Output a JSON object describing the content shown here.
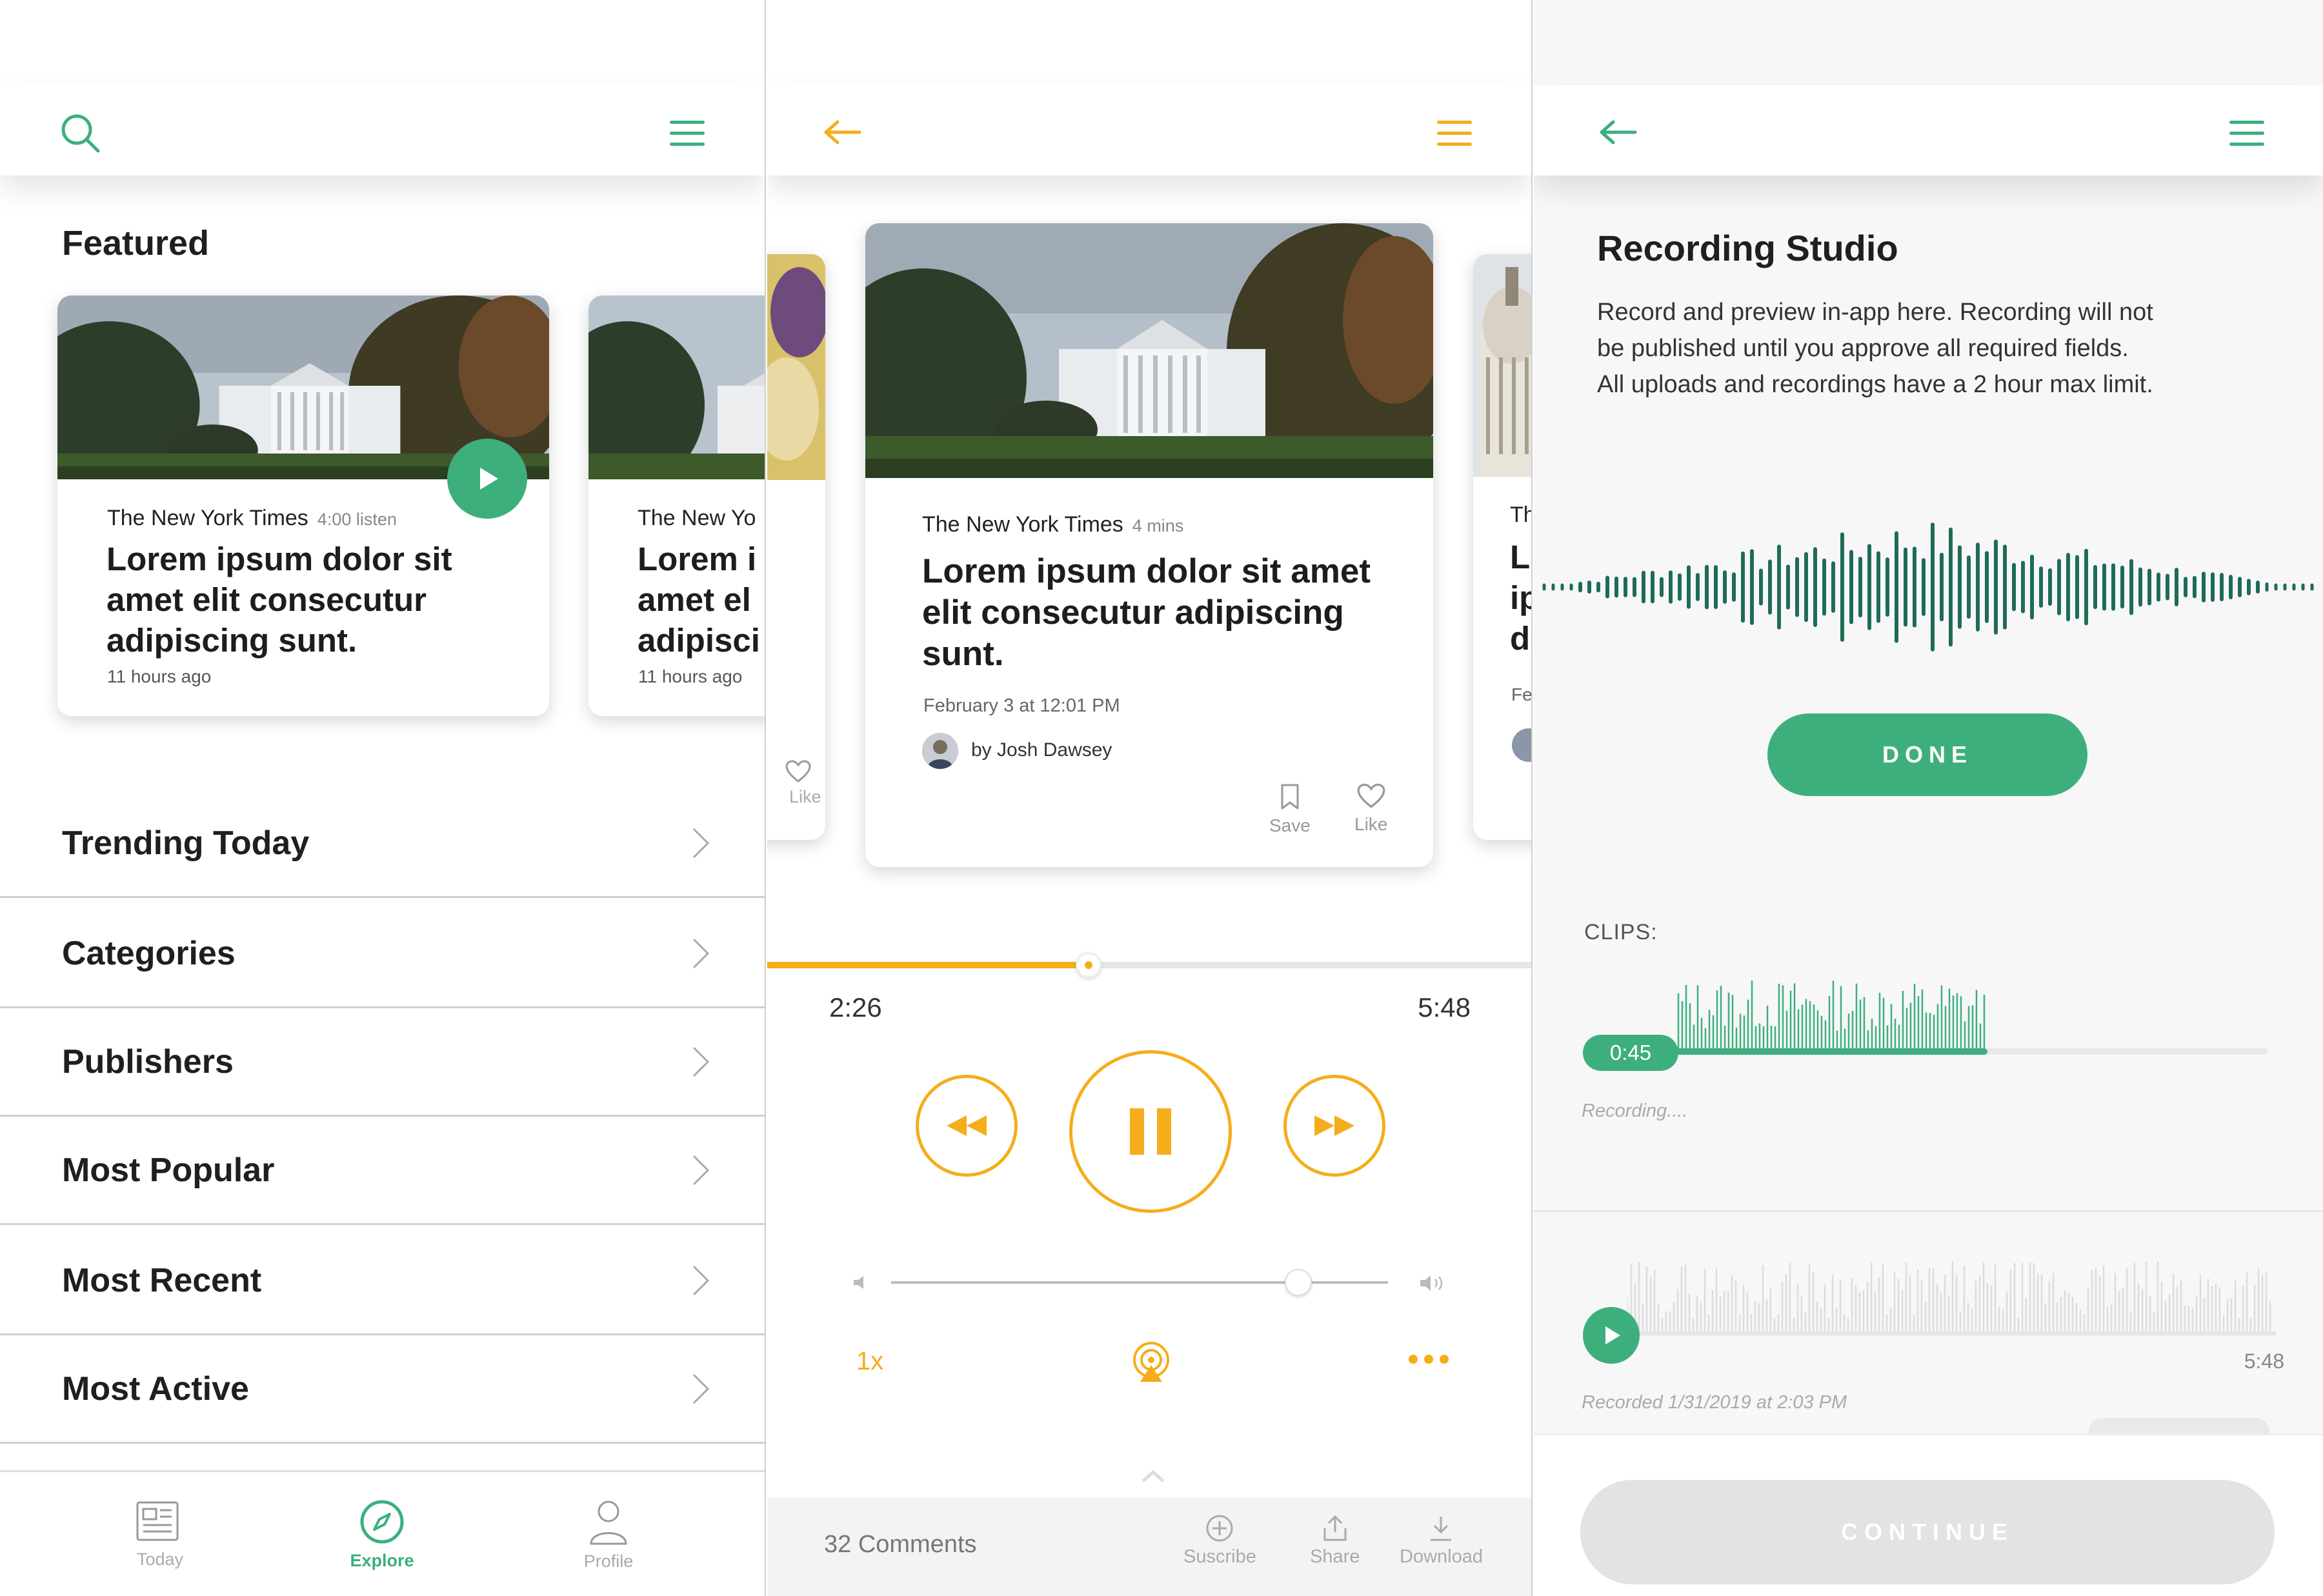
{
  "colors": {
    "green": "#3daf7d",
    "dark_green": "#1f6b5a",
    "orange": "#f5ad1b",
    "gray_line": "#cfcfcf"
  },
  "explore": {
    "featured_heading": "Featured",
    "cards": [
      {
        "publisher": "The New York Times",
        "duration": "4:00 listen",
        "title_lines": [
          "Lorem ipsum dolor sit",
          "amet elit consecutur",
          "adipiscing sunt."
        ],
        "ago": "11 hours ago"
      },
      {
        "publisher": "The New Yo",
        "title_lines": [
          "Lorem i",
          "amet el",
          "adipisci"
        ],
        "ago": "11 hours ago"
      }
    ],
    "list": [
      "Trending Today",
      "Categories",
      "Publishers",
      "Most Popular",
      "Most Recent",
      "Most Active"
    ],
    "tabs": [
      {
        "label": "Today",
        "icon": "newspaper-icon",
        "active": false
      },
      {
        "label": "Explore",
        "icon": "compass-icon",
        "active": true
      },
      {
        "label": "Profile",
        "icon": "person-icon",
        "active": false
      }
    ]
  },
  "player": {
    "peek_left_like": "Like",
    "card": {
      "publisher": "The New York Times",
      "duration": "4 mins",
      "title_lines": [
        "Lorem ipsum dolor sit amet",
        "elit consecutur adipiscing",
        "sunt."
      ],
      "date": "February 3 at 12:01 PM",
      "author": "by Josh Dawsey",
      "save_label": "Save",
      "like_label": "Like"
    },
    "peek_right": {
      "publisher": "Th",
      "title_lines": [
        "L",
        "ip",
        "d"
      ],
      "ago": "Fe"
    },
    "progress": 0.42,
    "elapsed": "2:26",
    "total": "5:48",
    "volume": 0.82,
    "speed": "1x",
    "comments": "32 Comments",
    "actions": [
      "Suscribe",
      "Share",
      "Download"
    ]
  },
  "studio": {
    "title": "Recording Studio",
    "description_lines": [
      "Record and preview in-app here. Recording will not",
      "be published until you approve all required fields.",
      "All uploads and recordings have a 2 hour max limit."
    ],
    "done_label": "DONE",
    "clips_label": "CLIPS:",
    "clip_time": "0:45",
    "clip_progress": 0.59,
    "recording_status": "Recording....",
    "clip2_duration": "5:48",
    "recorded_note": "Recorded 1/31/2019 at 2:03 PM",
    "continue_label": "CONTINUE"
  }
}
